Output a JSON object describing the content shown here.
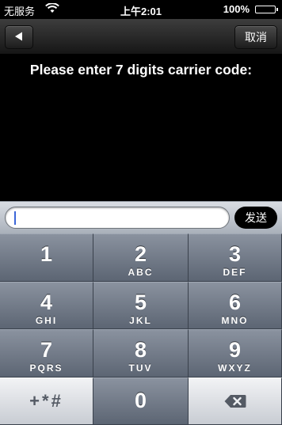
{
  "status": {
    "carrier": "无服务",
    "time": "上午2:01",
    "battery": "100%",
    "battery_level": 1.0
  },
  "nav": {
    "back_icon": "back-arrow-icon",
    "cancel_label": "取消"
  },
  "prompt": "Please enter 7 digits carrier code:",
  "input": {
    "value": "",
    "send_label": "发送"
  },
  "keypad": {
    "keys": [
      {
        "digit": "1",
        "letters": ""
      },
      {
        "digit": "2",
        "letters": "ABC"
      },
      {
        "digit": "3",
        "letters": "DEF"
      },
      {
        "digit": "4",
        "letters": "GHI"
      },
      {
        "digit": "5",
        "letters": "JKL"
      },
      {
        "digit": "6",
        "letters": "MNO"
      },
      {
        "digit": "7",
        "letters": "PQRS"
      },
      {
        "digit": "8",
        "letters": "TUV"
      },
      {
        "digit": "9",
        "letters": "WXYZ"
      }
    ],
    "symbols_label": "+*#",
    "zero": "0",
    "backspace_icon": "backspace-icon"
  }
}
